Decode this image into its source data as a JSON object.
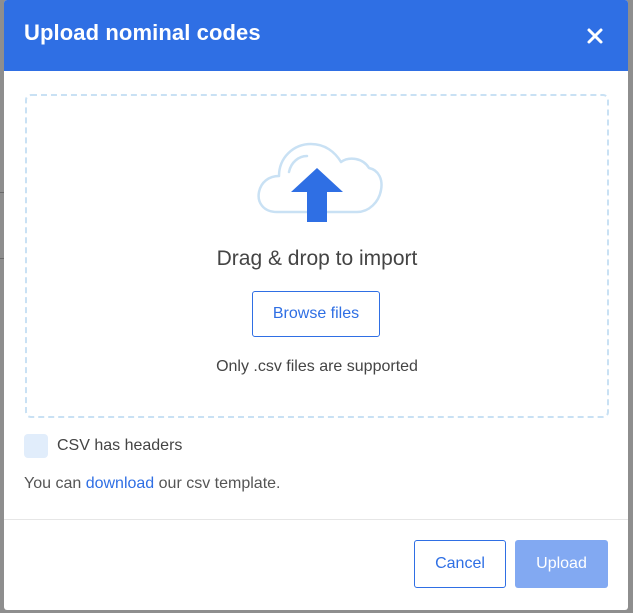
{
  "modal": {
    "title": "Upload nominal codes",
    "close_icon": "close-icon"
  },
  "dropzone": {
    "icon": "cloud-upload-icon",
    "heading": "Drag & drop to import",
    "browse_label": "Browse files",
    "support_text": "Only .csv files are supported"
  },
  "options": {
    "csv_headers_label": "CSV has headers",
    "csv_headers_checked": false
  },
  "template_note": {
    "prefix": "You can",
    "link": "download",
    "suffix": "our csv template."
  },
  "footer": {
    "cancel_label": "Cancel",
    "upload_label": "Upload"
  },
  "colors": {
    "primary": "#2f6fe4",
    "upload_disabled": "#82a9f2",
    "dropzone_border": "#c9e1f4",
    "checkbox_bg": "#e1edfb"
  }
}
